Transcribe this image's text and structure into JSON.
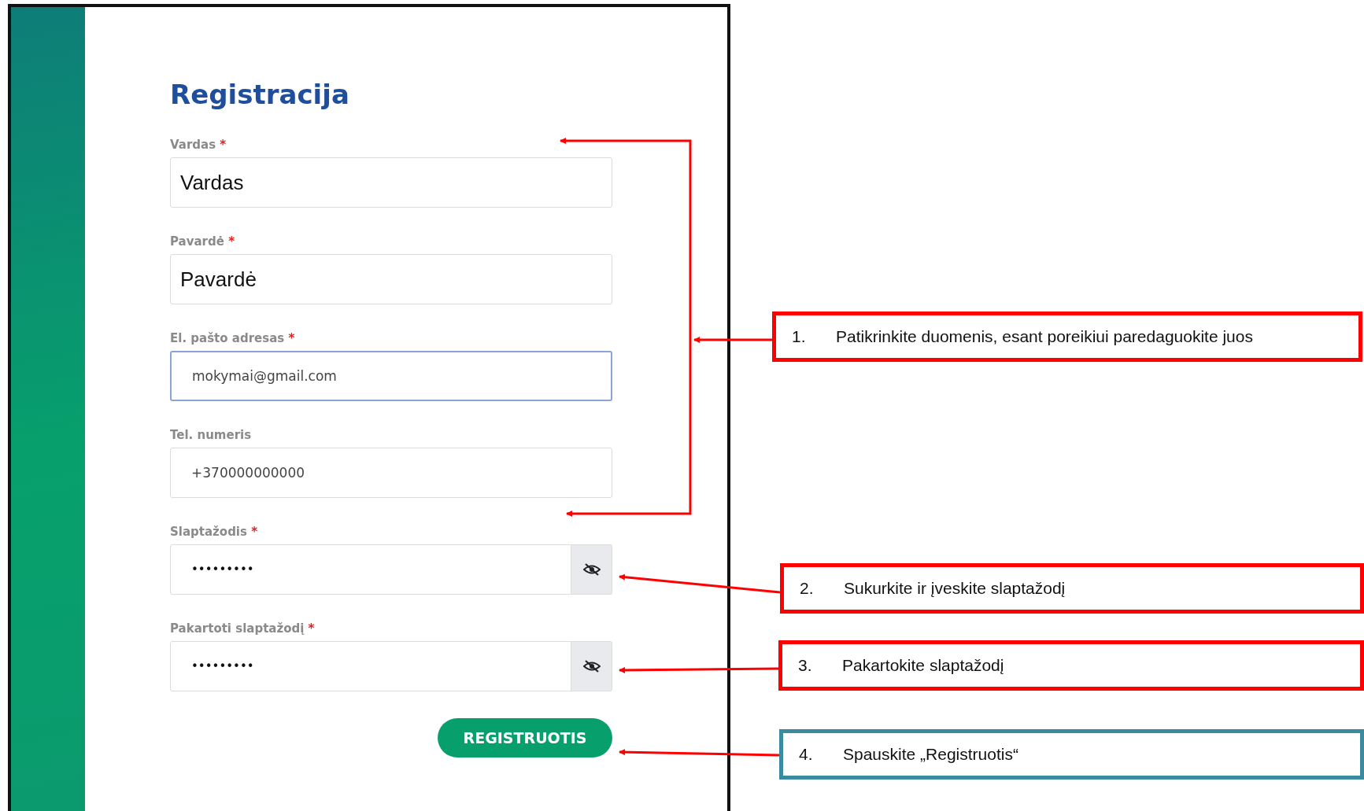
{
  "form": {
    "title": "Registracija",
    "fields": [
      {
        "label": "Vardas",
        "required": true,
        "kind": "typed",
        "value": "Vardas",
        "focused": false
      },
      {
        "label": "Pavardė",
        "required": true,
        "kind": "typed",
        "value": "Pavardė",
        "focused": false
      },
      {
        "label": "El. pašto adresas",
        "required": true,
        "kind": "text",
        "value": "mokymai@gmail.com",
        "focused": true
      },
      {
        "label": "Tel. numeris",
        "required": false,
        "kind": "text",
        "value": "+370000000000",
        "focused": false
      },
      {
        "label": "Slaptažodis",
        "required": true,
        "kind": "password",
        "value": "•••••••••",
        "focused": false
      },
      {
        "label": "Pakartoti slaptažodį",
        "required": true,
        "kind": "password",
        "value": "•••••••••",
        "focused": false
      }
    ],
    "required_mark": "*",
    "submit": "REGISTRUOTIS"
  },
  "callouts": [
    {
      "number": "1.",
      "text": "Patikrinkite duomenis, esant poreikiui paredaguokite juos",
      "color": "#ff0000"
    },
    {
      "number": "2.",
      "text": "Sukurkite ir įveskite slaptažodį",
      "color": "#ff0000"
    },
    {
      "number": "3.",
      "text": "Pakartokite slaptažodį",
      "color": "#ff0000"
    },
    {
      "number": "4.",
      "text": "Spauskite „Registruotis“",
      "color": "#3a8aa0"
    }
  ]
}
